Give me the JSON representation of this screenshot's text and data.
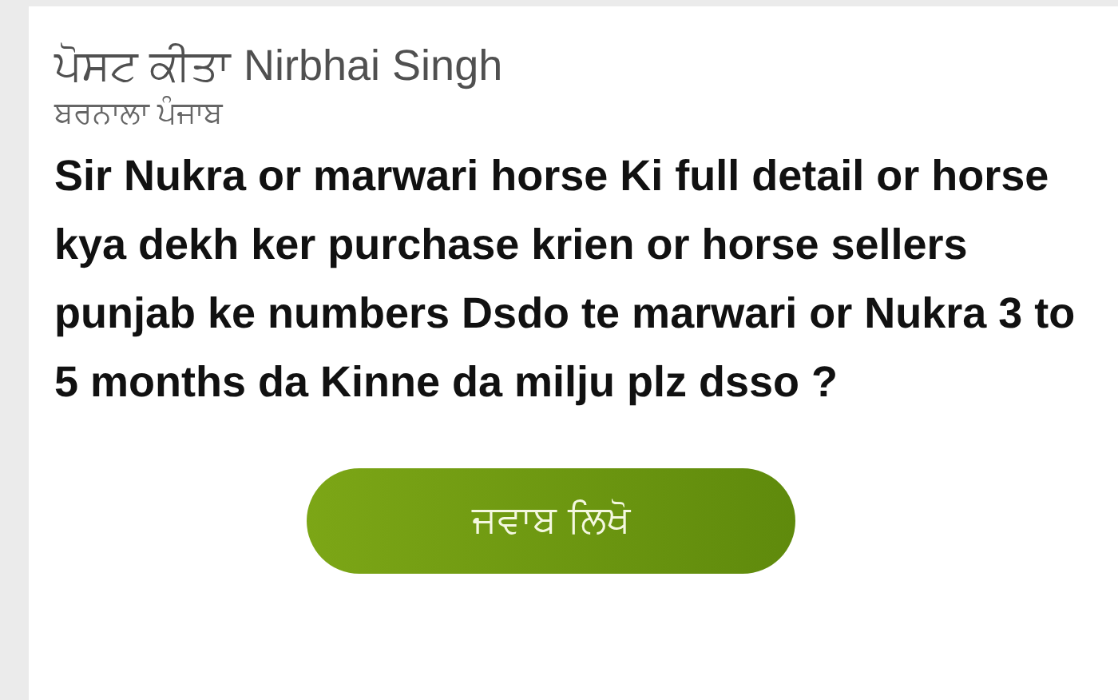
{
  "post": {
    "posted_by_label": "ਪੋਸਟ ਕੀਤਾ",
    "author": "Nirbhai Singh",
    "location": "ਬਰਨਾਲਾ ਪੰਜਾਬ",
    "question": "Sir Nukra or marwari horse Ki full detail or horse kya dekh ker purchase krien or horse sellers punjab ke numbers Dsdo te marwari or Nukra 3 to 5 months da Kinne da milju plz dsso ?",
    "answer_button": "ਜਵਾਬ ਲਿਖੋ"
  }
}
